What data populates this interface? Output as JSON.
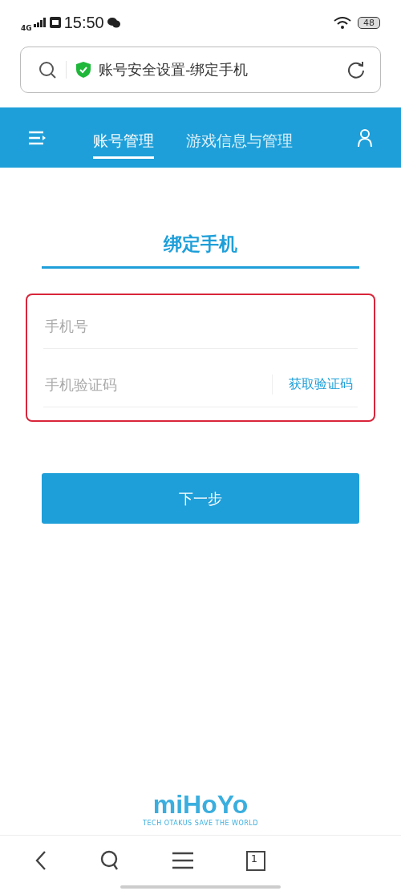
{
  "status_bar": {
    "network": "4G",
    "time": "15:50",
    "battery": "48"
  },
  "address_bar": {
    "title": "账号安全设置-绑定手机"
  },
  "nav": {
    "tabs": [
      {
        "label": "账号管理",
        "selected": true
      },
      {
        "label": "游戏信息与管理",
        "selected": false
      }
    ]
  },
  "page": {
    "heading": "绑定手机",
    "fields": [
      {
        "kind": "text",
        "placeholder": "手机号"
      },
      {
        "kind": "code",
        "placeholder": "手机验证码",
        "action": "获取验证码"
      }
    ],
    "next_button": "下一步"
  },
  "logo": {
    "name": "miHoYo",
    "tagline": "TECH OTAKUS SAVE THE WORLD"
  },
  "bottom_bar": {
    "tab_count": "1"
  }
}
